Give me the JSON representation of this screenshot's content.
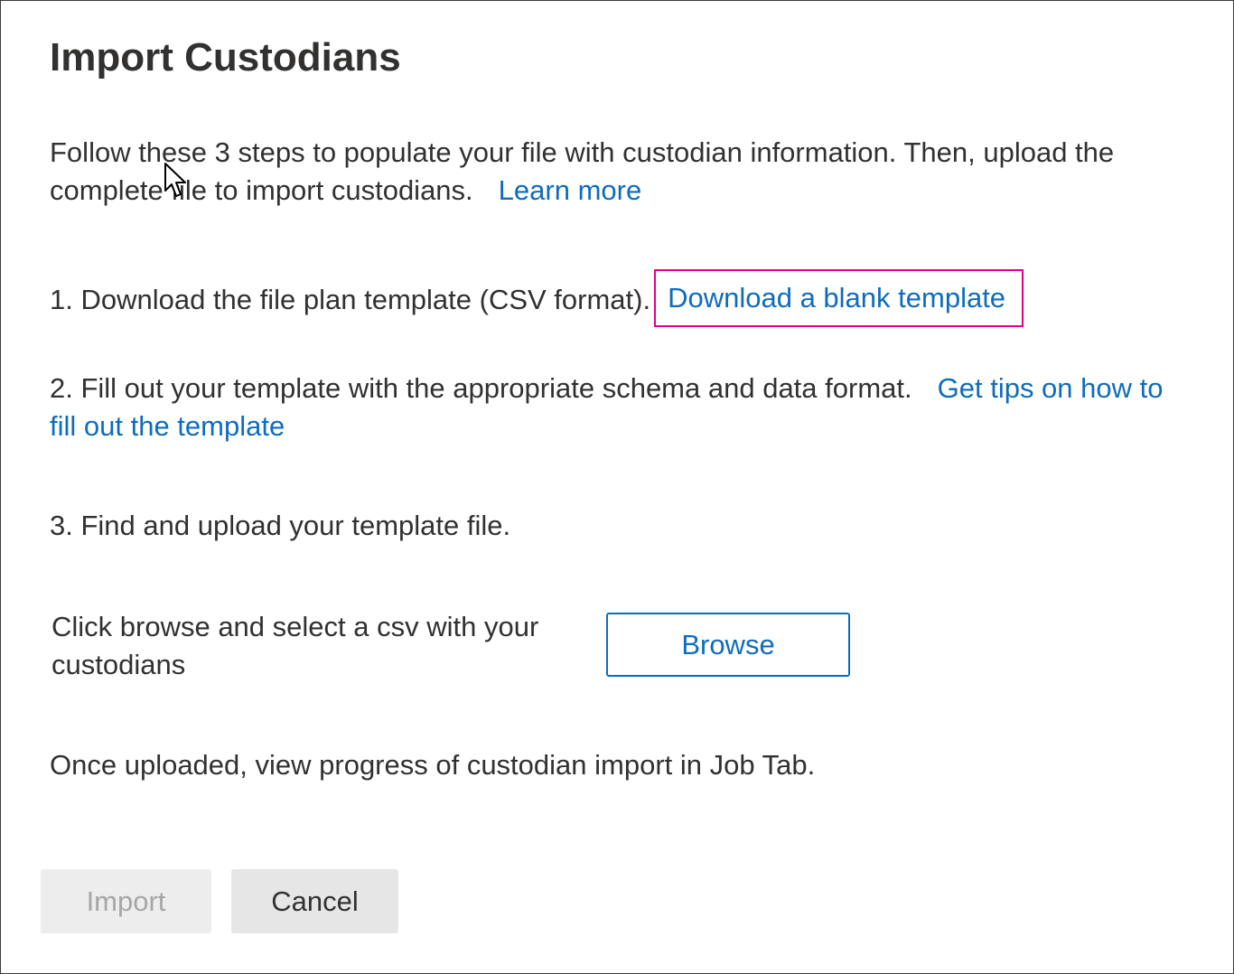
{
  "dialog": {
    "title": "Import Custodians",
    "intro": {
      "text": "Follow these 3 steps to populate your file with custodian information. Then, upload the complete file to import custodians.",
      "link": "Learn more"
    },
    "step1": {
      "text": "1. Download the file plan template (CSV format).",
      "link": "Download a blank template"
    },
    "step2": {
      "text": "2. Fill out your template with the appropriate schema and data format.",
      "link": "Get tips on how to fill out the template"
    },
    "step3": {
      "text": "3. Find and upload your template file."
    },
    "browse": {
      "label": "Click browse and select a csv with your custodians",
      "button": "Browse"
    },
    "note": "Once uploaded, view progress of custodian import in Job Tab.",
    "buttons": {
      "import": "Import",
      "cancel": "Cancel"
    }
  },
  "colors": {
    "link": "#0f6cbd",
    "highlight": "#e3008c",
    "text": "#323130"
  },
  "icons": {
    "cursor": "mouse-pointer-icon"
  }
}
